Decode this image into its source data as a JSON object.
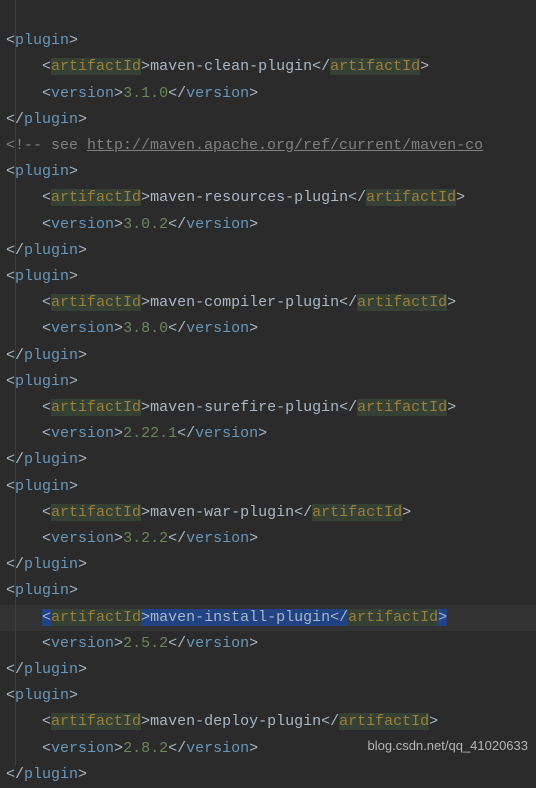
{
  "tagnames": {
    "plugin": "plugin",
    "artifact": "artifactId",
    "version": "version"
  },
  "comment": {
    "prefix": "<!-- see ",
    "url": "http://maven.apache.org/ref/current/maven-co"
  },
  "plugins": [
    {
      "artifact": "maven-clean-plugin",
      "version": "3.1.0"
    },
    {
      "artifact": "maven-resources-plugin",
      "version": "3.0.2"
    },
    {
      "artifact": "maven-compiler-plugin",
      "version": "3.8.0"
    },
    {
      "artifact": "maven-surefire-plugin",
      "version": "2.22.1"
    },
    {
      "artifact": "maven-war-plugin",
      "version": "3.2.2"
    },
    {
      "artifact": "maven-install-plugin",
      "version": "2.5.2"
    },
    {
      "artifact": "maven-deploy-plugin",
      "version": "2.8.2"
    }
  ],
  "watermark": "blog.csdn.net/qq_41020633"
}
